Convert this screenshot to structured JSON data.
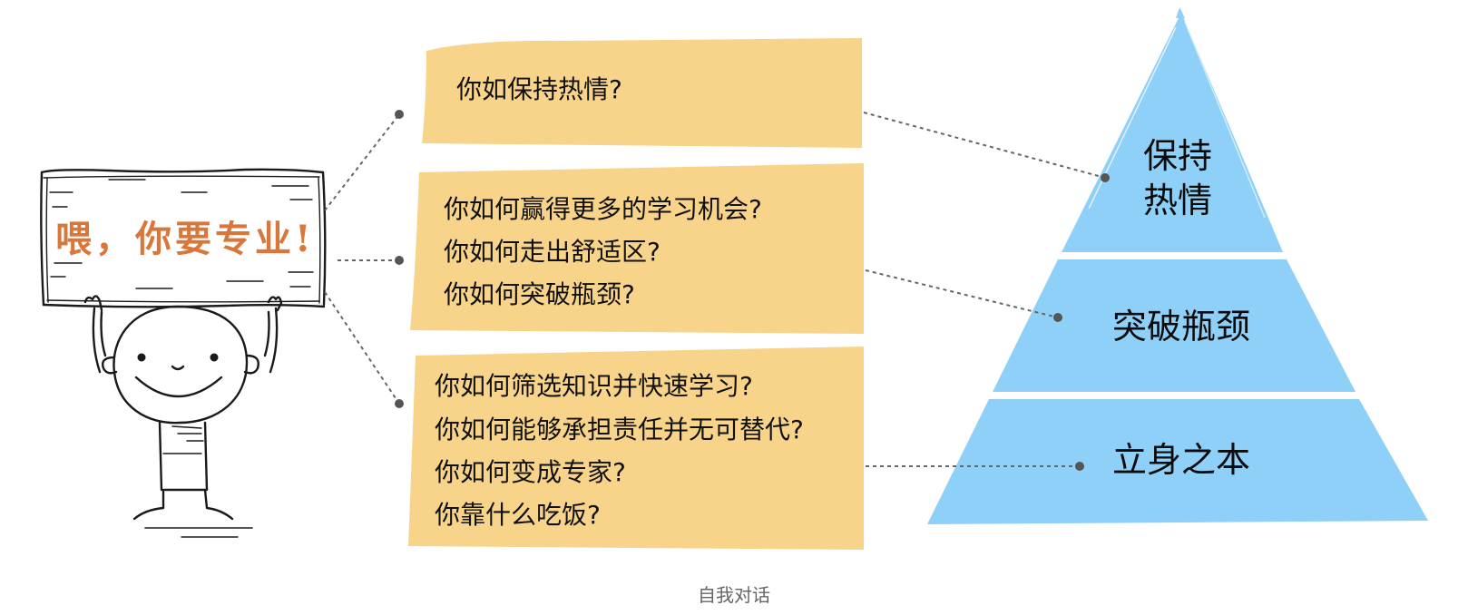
{
  "sign": {
    "text": "喂，你要专业!"
  },
  "boxes": [
    {
      "lines": [
        "你如保持热情?"
      ]
    },
    {
      "lines": [
        "你如何赢得更多的学习机会?",
        "你如何走出舒适区?",
        "你如何突破瓶颈?"
      ]
    },
    {
      "lines": [
        "你如何筛选知识并快速学习?",
        "你如何能够承担责任并无可替代?",
        "你如何变成专家?",
        "你靠什么吃饭?"
      ]
    }
  ],
  "pyramid": {
    "top": [
      "保持",
      "热情"
    ],
    "middle": "突破瓶颈",
    "bottom": "立身之本"
  },
  "caption": "自我对话",
  "colors": {
    "box_fill": "#f8d48a",
    "pyramid_fill": "#8fd0f8",
    "sign_text": "#d9773a"
  }
}
